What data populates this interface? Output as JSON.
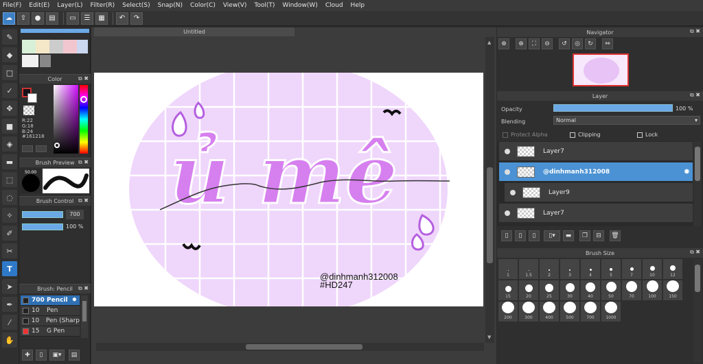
{
  "menu": [
    "File(F)",
    "Edit(E)",
    "Layer(L)",
    "Filter(R)",
    "Select(S)",
    "Snap(N)",
    "Color(C)",
    "View(V)",
    "Tool(T)",
    "Window(W)",
    "Cloud",
    "Help"
  ],
  "document_tab": "Untitled",
  "color_panel": {
    "title": "Color",
    "r": "R:22",
    "g": "G:18",
    "b": "B:24",
    "hex": "#161218"
  },
  "brush_preview": {
    "title": "Brush Preview",
    "size": "50.00"
  },
  "brush_control": {
    "title": "Brush Control",
    "size": "700",
    "opacity": "100 %"
  },
  "brush_list": {
    "title": "Brush: Pencil",
    "items": [
      {
        "size": "700",
        "name": "Pencil"
      },
      {
        "size": "10",
        "name": "Pen"
      },
      {
        "size": "10",
        "name": "Pen (Sharp"
      },
      {
        "size": "15",
        "name": "G Pen"
      }
    ]
  },
  "navigator": {
    "title": "Navigator"
  },
  "layer_panel": {
    "title": "Layer",
    "opacity_label": "Opacity",
    "opacity_value": "100 %",
    "blending_label": "Blending",
    "blending_value": "Normal",
    "protect_alpha": "Protect Alpha",
    "clipping": "Clipping",
    "lock": "Lock",
    "layers": [
      {
        "name": "Layer7"
      },
      {
        "name": "@dinhmanh312008"
      },
      {
        "name": "Layer9"
      },
      {
        "name": "Layer7"
      }
    ]
  },
  "brush_size": {
    "title": "Brush Size",
    "sizes": [
      "1",
      "1.5",
      "2",
      "3",
      "4",
      "5",
      "7",
      "10",
      "12",
      "15",
      "20",
      "25",
      "30",
      "40",
      "50",
      "70",
      "100",
      "150",
      "200",
      "300",
      "400",
      "500",
      "700",
      "1000"
    ]
  },
  "canvas": {
    "art_title": "ủ mê",
    "credit1": "@dinhmanh312008",
    "credit2": "#HD247"
  },
  "colors": {
    "accent": "#4b92d4",
    "pink": "#e9a6f0",
    "lilac": "#eed6fa",
    "purple": "#b86ee8"
  }
}
